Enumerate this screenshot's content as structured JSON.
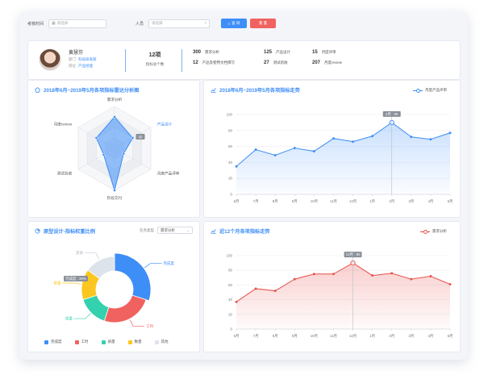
{
  "filter": {
    "time_label": "考核时间",
    "time_placeholder": "请选择",
    "person_label": "人员",
    "person_placeholder": "请选择",
    "query_label": "查 询",
    "reset_label": "重 置"
  },
  "user": {
    "name": "黄慧芬",
    "dept_label": "部门",
    "dept_value": "科技研发部",
    "role_label": "岗位",
    "role_value": "产品经理"
  },
  "summary": {
    "total_value": "12项",
    "total_label": "指标总个数",
    "stats": [
      {
        "value": "300",
        "label": "需求分析"
      },
      {
        "value": "125",
        "label": "产品设计"
      },
      {
        "value": "15",
        "label": "月度评审"
      },
      {
        "value": "12",
        "label": "产品及使用文档撰写"
      },
      {
        "value": "27",
        "label": "测试验收"
      },
      {
        "value": "207",
        "label": "月度review"
      }
    ]
  },
  "colors": {
    "blue": "#3e8ef7",
    "red": "#e8514c",
    "pie": [
      "#3e8ef7",
      "#f0625f",
      "#33d1ad",
      "#fbc61f",
      "#dde3ea"
    ]
  },
  "radar": {
    "title": "2018年6月~2019年5月各项指标雷达分析图",
    "axes": [
      "需求分析",
      "产品设计",
      "月度产品评审",
      "阶段交付",
      "测试验收",
      "月度review"
    ],
    "values": [
      0.75,
      0.5,
      0.25,
      1.0,
      0.3,
      0.5
    ],
    "tooltip": "50"
  },
  "line_top": {
    "title": "2018年6月~2019年5月各项指标走势",
    "legend": "月度产品评审",
    "tooltip": "2月 : 90",
    "tooltip_index": 8
  },
  "pie": {
    "title": "原型设计-指标权重比例",
    "task_label": "任务类型",
    "task_value": "需求分析",
    "labels": [
      "完成度",
      "工时",
      "质量",
      "数量",
      "其他"
    ],
    "values": [
      30,
      25,
      15,
      15,
      15
    ],
    "tooltip": "完成度 : 30%"
  },
  "line_bottom": {
    "title": "近12个月各项指标走势",
    "legend": "需求分析",
    "tooltip": "12月 : 90",
    "tooltip_index": 6
  },
  "chart_data": [
    {
      "type": "radar",
      "title": "2018年6月~2019年5月各项指标雷达分析图",
      "axes": [
        "需求分析",
        "产品设计",
        "月度产品评审",
        "阶段交付",
        "测试验收",
        "月度review"
      ],
      "values": [
        0.75,
        0.5,
        0.25,
        1.0,
        0.3,
        0.5
      ]
    },
    {
      "type": "line",
      "title": "2018年6月~2019年5月各项指标走势",
      "x": [
        "6月",
        "7月",
        "8月",
        "9月",
        "10月",
        "11月",
        "12月",
        "1月",
        "2月",
        "3月",
        "4月",
        "5月"
      ],
      "series": [
        {
          "name": "月度产品评审",
          "values": [
            35,
            56,
            49,
            58,
            54,
            70,
            66,
            73,
            90,
            72,
            69,
            77
          ]
        }
      ],
      "ylim": [
        0,
        100
      ],
      "yticks": [
        0,
        20,
        40,
        60,
        80,
        100
      ]
    },
    {
      "type": "pie",
      "title": "原型设计-指标权重比例",
      "categories": [
        "完成度",
        "工时",
        "质量",
        "数量",
        "其他"
      ],
      "values": [
        30,
        25,
        15,
        15,
        15
      ]
    },
    {
      "type": "line",
      "title": "近12个月各项指标走势",
      "x": [
        "6月",
        "7月",
        "8月",
        "9月",
        "10月",
        "11月",
        "12月",
        "1月",
        "2月",
        "3月",
        "4月",
        "5月"
      ],
      "series": [
        {
          "name": "需求分析",
          "values": [
            37,
            55,
            52,
            68,
            75,
            75,
            90,
            73,
            76,
            68,
            72,
            61
          ]
        }
      ],
      "ylim": [
        0,
        100
      ],
      "yticks": [
        0,
        20,
        40,
        60,
        80,
        100
      ]
    }
  ]
}
